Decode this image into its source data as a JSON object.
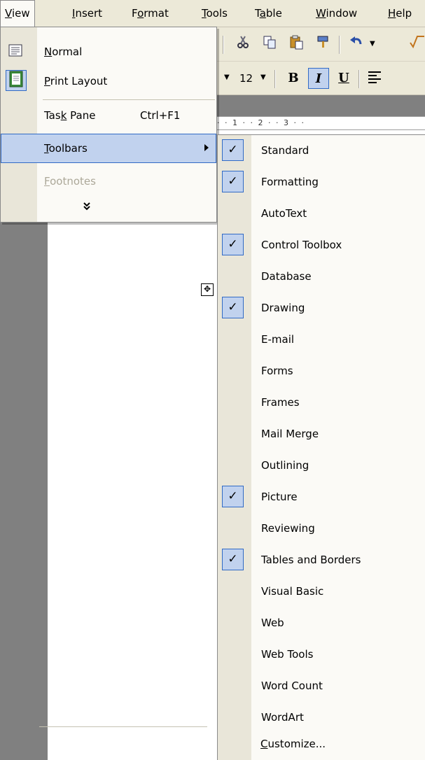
{
  "menubar": {
    "items": [
      {
        "pre": "",
        "acc": "V",
        "post": "iew",
        "active": true
      },
      {
        "pre": "",
        "acc": "I",
        "post": "nsert"
      },
      {
        "pre": "F",
        "acc": "o",
        "post": "rmat"
      },
      {
        "pre": "",
        "acc": "T",
        "post": "ools"
      },
      {
        "pre": "T",
        "acc": "a",
        "post": "ble"
      },
      {
        "pre": "",
        "acc": "W",
        "post": "indow"
      },
      {
        "pre": "",
        "acc": "H",
        "post": "elp"
      }
    ]
  },
  "toolbar": {
    "font_size": "12",
    "bold_label": "B",
    "italic_label": "I",
    "underline_label": "U"
  },
  "ruler": {
    "text": "·  ·  1  ·  ·  2  ·  ·  3  ·  ·"
  },
  "view_menu": {
    "items": [
      {
        "pre": "",
        "acc": "N",
        "post": "ormal",
        "icon": "normal-view-icon"
      },
      {
        "pre": "",
        "acc": "P",
        "post": "rint Layout",
        "icon": "print-layout-icon",
        "selected": true
      },
      {
        "pre": "Tas",
        "acc": "k",
        "post": " Pane",
        "shortcut": "Ctrl+F1"
      },
      {
        "pre": "",
        "acc": "T",
        "post": "oolbars",
        "submenu": true,
        "highlighted": true
      },
      {
        "pre": "",
        "acc": "F",
        "post": "ootnotes",
        "disabled": true
      }
    ],
    "expand_label": "»"
  },
  "toolbars_submenu": {
    "items": [
      {
        "label": "Standard",
        "checked": true
      },
      {
        "label": "Formatting",
        "checked": true
      },
      {
        "label": "AutoText",
        "checked": false
      },
      {
        "label": "Control Toolbox",
        "checked": true
      },
      {
        "label": "Database",
        "checked": false
      },
      {
        "label": "Drawing",
        "checked": true
      },
      {
        "label": "E-mail",
        "checked": false
      },
      {
        "label": "Forms",
        "checked": false
      },
      {
        "label": "Frames",
        "checked": false
      },
      {
        "label": "Mail Merge",
        "checked": false
      },
      {
        "label": "Outlining",
        "checked": false
      },
      {
        "label": "Picture",
        "checked": true
      },
      {
        "label": "Reviewing",
        "checked": false
      },
      {
        "label": "Tables and Borders",
        "checked": true
      },
      {
        "label": "Visual Basic",
        "checked": false
      },
      {
        "label": "Web",
        "checked": false
      },
      {
        "label": "Web Tools",
        "checked": false
      },
      {
        "label": "Word Count",
        "checked": false
      },
      {
        "label": "WordArt",
        "checked": false
      }
    ],
    "customize": {
      "pre": "",
      "acc": "C",
      "post": "ustomize..."
    },
    "check_glyph": "✓"
  },
  "colors": {
    "menu_bg": "#ece9d8",
    "highlight": "#c1d2ee",
    "highlight_border": "#316ac5",
    "disabled_text": "#aca899"
  }
}
